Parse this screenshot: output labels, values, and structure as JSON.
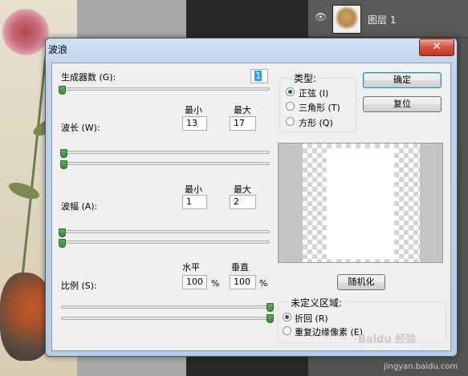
{
  "layers_panel": {
    "layer_name": "图层 1"
  },
  "dialog": {
    "title": "波浪",
    "close_label": "✕",
    "generators": {
      "label": "生成器数 (G):",
      "value": "1"
    },
    "wavelength": {
      "label": "波长 (W):",
      "min_label": "最小",
      "max_label": "最大",
      "min_value": "13",
      "max_value": "17"
    },
    "amplitude": {
      "label": "波幅 (A):",
      "min_label": "最小",
      "max_label": "最大",
      "min_value": "1",
      "max_value": "2"
    },
    "scale": {
      "label": "比例 (S):",
      "h_label": "水平",
      "v_label": "垂直",
      "h_value": "100",
      "v_value": "100",
      "unit": "%"
    },
    "type": {
      "title": "类型:",
      "options": [
        {
          "label": "正弦 (I)",
          "selected": true
        },
        {
          "label": "三角形 (T)",
          "selected": false
        },
        {
          "label": "方形 (Q)",
          "selected": false
        }
      ]
    },
    "buttons": {
      "ok": "确定",
      "reset": "复位",
      "randomize": "随机化"
    },
    "undefined_areas": {
      "title": "未定义区域:",
      "options": [
        {
          "label": "折回 (R)",
          "selected": true
        },
        {
          "label": "重复边缘像素 (E)",
          "selected": false
        }
      ]
    }
  },
  "watermark": {
    "text": "Baidu 经验",
    "sub": "jingyan.baidu.com"
  }
}
